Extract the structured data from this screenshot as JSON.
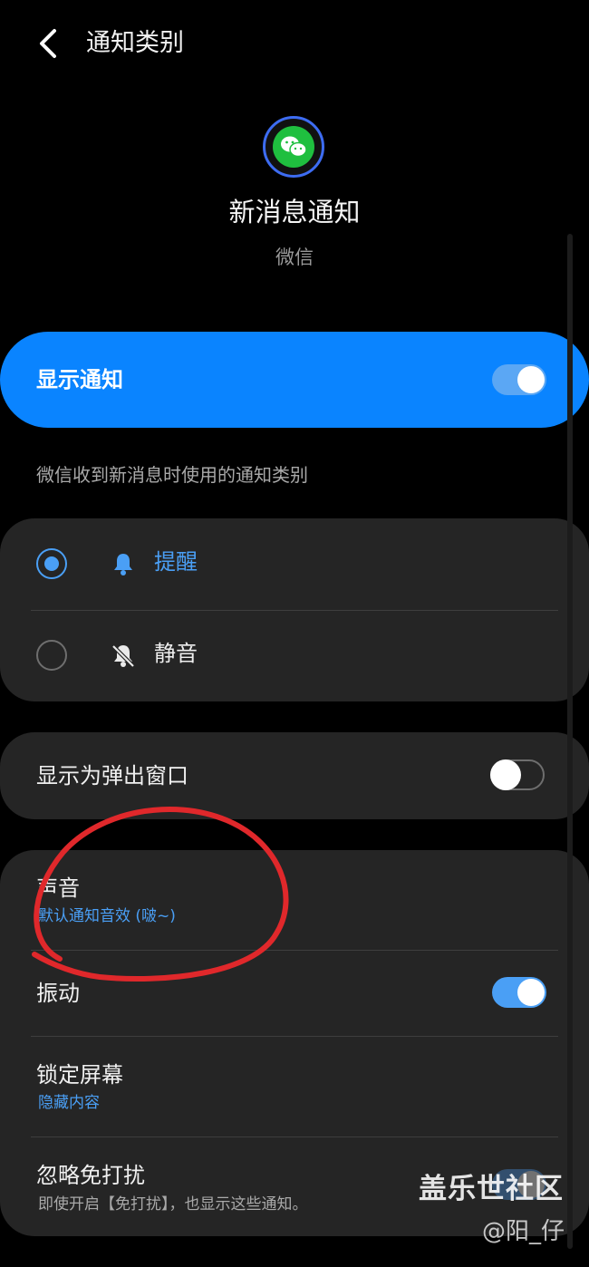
{
  "header": {
    "title": "通知类别",
    "back_icon": "back-arrow-icon"
  },
  "app": {
    "icon": "wechat-icon",
    "channel_name": "新消息通知",
    "app_name": "微信"
  },
  "master_toggle": {
    "label": "显示通知",
    "on": true
  },
  "description": "微信收到新消息时使用的通知类别",
  "alert_type": {
    "options": [
      {
        "label": "提醒",
        "icon": "bell-icon",
        "selected": true
      },
      {
        "label": "静音",
        "icon": "bell-off-icon",
        "selected": false
      }
    ]
  },
  "popup": {
    "label": "显示为弹出窗口",
    "on": false
  },
  "settings": {
    "sound": {
      "label": "声音",
      "value": "默认通知音效 (啵~)"
    },
    "vibration": {
      "label": "振动",
      "on": true
    },
    "lock_screen": {
      "label": "锁定屏幕",
      "value": "隐藏内容"
    },
    "dnd": {
      "label": "忽略免打扰",
      "description": "即使开启【免打扰】，也显示这些通知。"
    }
  },
  "watermark": {
    "site": "盖乐世社区",
    "author": "@阳_仔"
  },
  "colors": {
    "accent": "#0a84ff",
    "link": "#4a9ff5",
    "card": "#252525",
    "annotation": "#e0282b"
  }
}
